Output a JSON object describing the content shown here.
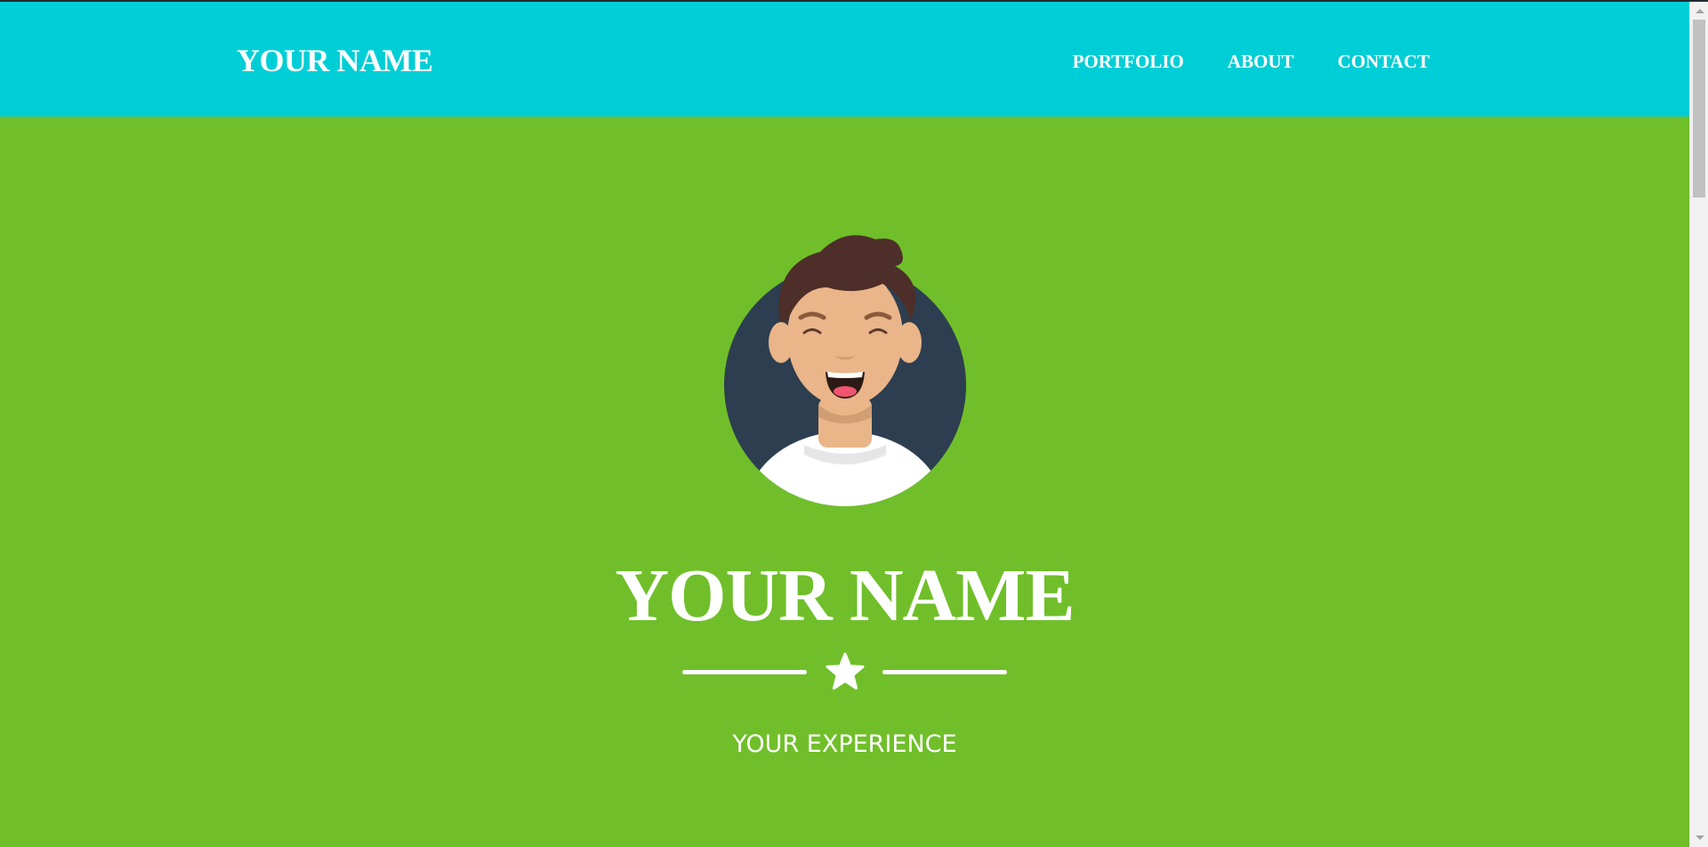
{
  "navbar": {
    "brand": "YOUR NAME",
    "links": [
      "PORTFOLIO",
      "ABOUT",
      "CONTACT"
    ]
  },
  "hero": {
    "title": "YOUR NAME",
    "subtitle": "YOUR EXPERIENCE",
    "avatar_icon": "avatar-illustration",
    "divider_icon": "star-icon"
  },
  "colors": {
    "navbar_bg": "#00ced6",
    "hero_bg": "#70bf2a",
    "text": "#ffffff",
    "avatar_bg": "#2d3e50",
    "hair": "#4e2e29",
    "skin": "#e9b589"
  }
}
